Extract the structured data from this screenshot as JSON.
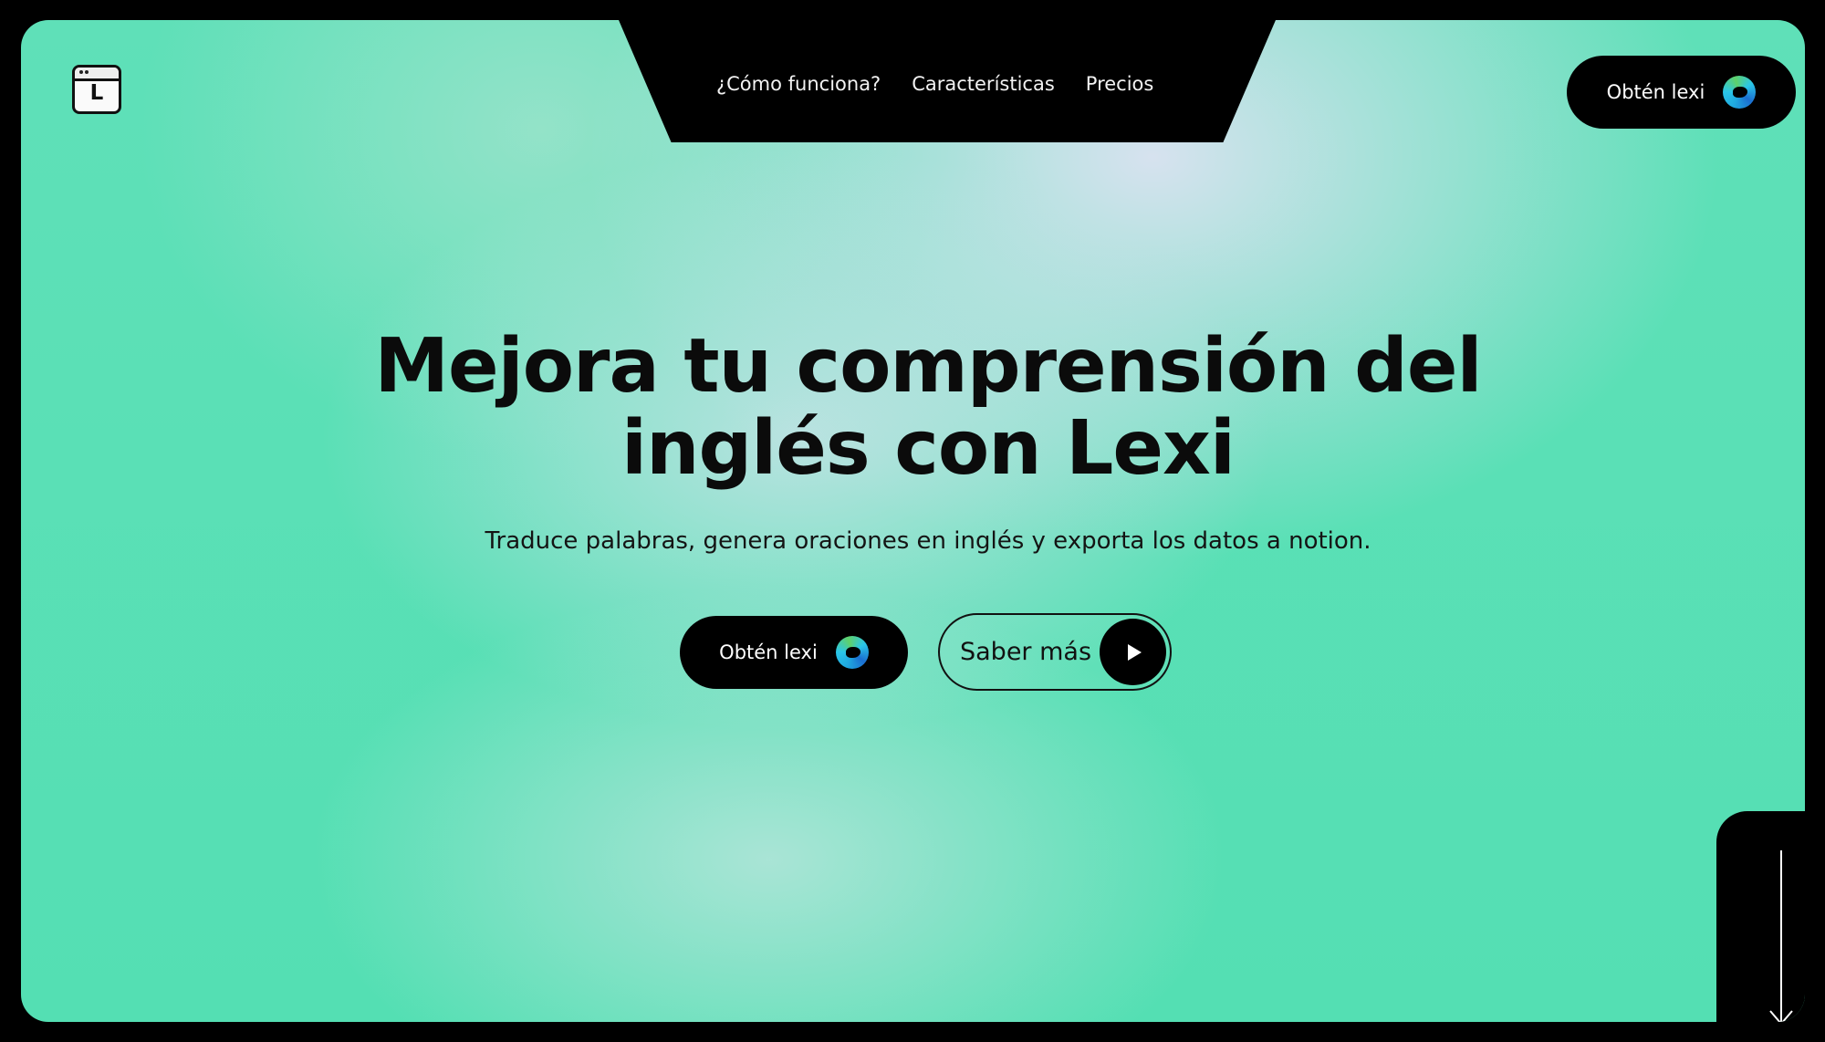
{
  "brand": {
    "logo_letter": "L"
  },
  "nav": {
    "items": [
      {
        "label": "¿Cómo funciona?"
      },
      {
        "label": "Características"
      },
      {
        "label": "Precios"
      }
    ]
  },
  "header": {
    "cta_label": "Obtén lexi",
    "cta_icon": "edge-browser-icon"
  },
  "hero": {
    "headline_line1": "Mejora tu comprensión del",
    "headline_line2": "inglés con Lexi",
    "subtitle": "Traduce palabras, genera oraciones en inglés y exporta los datos a notion.",
    "primary_cta_label": "Obtén lexi",
    "primary_cta_icon": "edge-browser-icon",
    "secondary_cta_label": "Saber más",
    "secondary_cta_icon": "play-icon"
  },
  "scroll_indicator": {
    "icon": "arrow-down-icon"
  },
  "colors": {
    "hero_green": "#54dfb3",
    "hero_lavender": "#dde2f2",
    "frame_black": "#000000",
    "text_dark": "#0b0b0b"
  }
}
